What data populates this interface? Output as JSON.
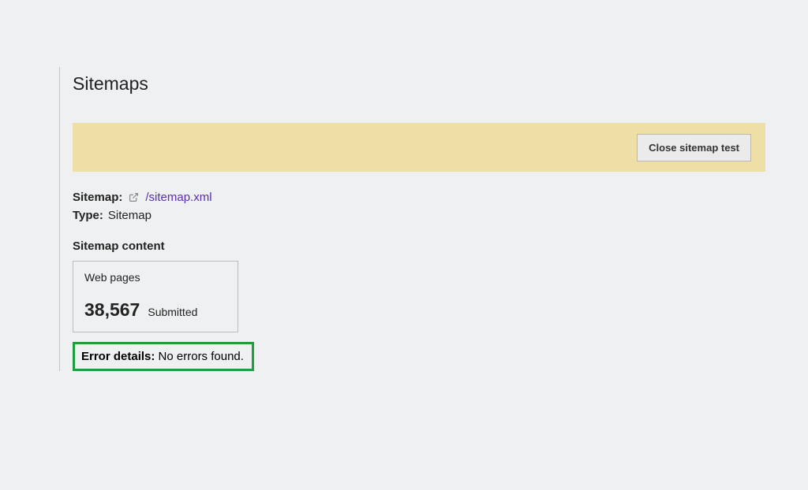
{
  "page_title": "Sitemaps",
  "banner": {
    "close_label": "Close sitemap test"
  },
  "sitemap": {
    "label": "Sitemap:",
    "link_text": "/sitemap.xml"
  },
  "type": {
    "label": "Type:",
    "value": "Sitemap"
  },
  "content_section": {
    "heading": "Sitemap content",
    "card_label": "Web pages",
    "count": "38,567",
    "status": "Submitted"
  },
  "errors": {
    "label": "Error details:",
    "value": "No errors found."
  },
  "colors": {
    "banner_bg": "#eddfa5",
    "link": "#5c2db3",
    "highlight_border": "#1e9e3f"
  }
}
